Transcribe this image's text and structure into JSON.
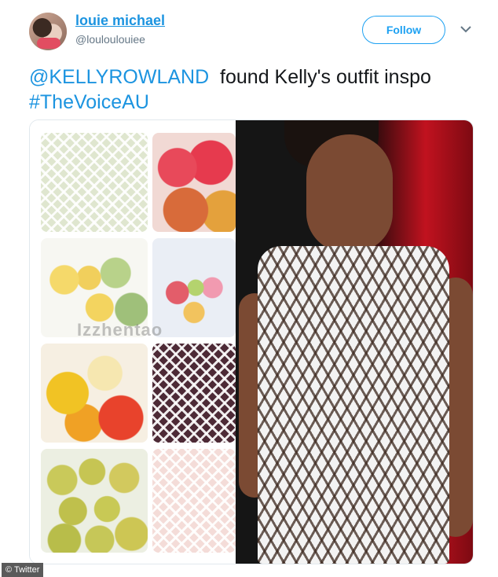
{
  "user": {
    "display_name": "louie michael",
    "handle": "@louloulouiee"
  },
  "actions": {
    "follow_label": "Follow"
  },
  "tweet": {
    "mention": "@KELLYROWLAND",
    "text": "found Kelly's outfit inspo",
    "hashtag": "#TheVoiceAU"
  },
  "media": {
    "collage_watermark": "Izzhentao",
    "grid_cells": [
      "net-wrapped-fruit",
      "red-apples",
      "pears-in-netting",
      "colored-foam-nets",
      "orange-nets",
      "white-net-sleeve",
      "green-pears",
      "foam-net-roll"
    ]
  },
  "footer": {
    "source_label": "© Twitter"
  },
  "colors": {
    "link": "#1c94e0",
    "follow_border": "#1da1f2",
    "handle_gray": "#657786"
  }
}
